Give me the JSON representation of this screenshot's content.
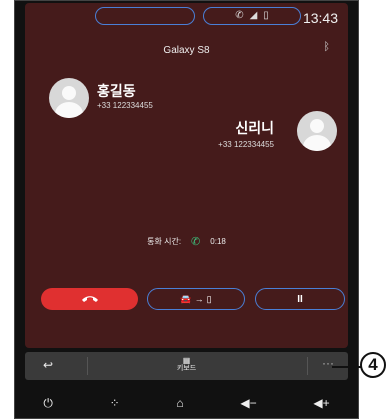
{
  "status": {
    "time": "13:43",
    "icons": [
      "phone-icon",
      "signal-icon",
      "battery-icon"
    ]
  },
  "call": {
    "device_name": "Galaxy S8",
    "caller1": {
      "name": "홍길동",
      "number": "+33 122334455"
    },
    "caller2": {
      "name": "신리니",
      "number": "+33 122334455"
    },
    "duration_label": "통화 시간:",
    "duration_value": "0:18"
  },
  "actions": {
    "hold_label": "II"
  },
  "bar": {
    "keypad_label": "키보드",
    "more_label": "···"
  },
  "callout": {
    "number": "4"
  },
  "colors": {
    "background": "#451b1b",
    "hangup": "#e03030",
    "outline": "#4a7fd6",
    "active_call": "#3dc27d"
  }
}
